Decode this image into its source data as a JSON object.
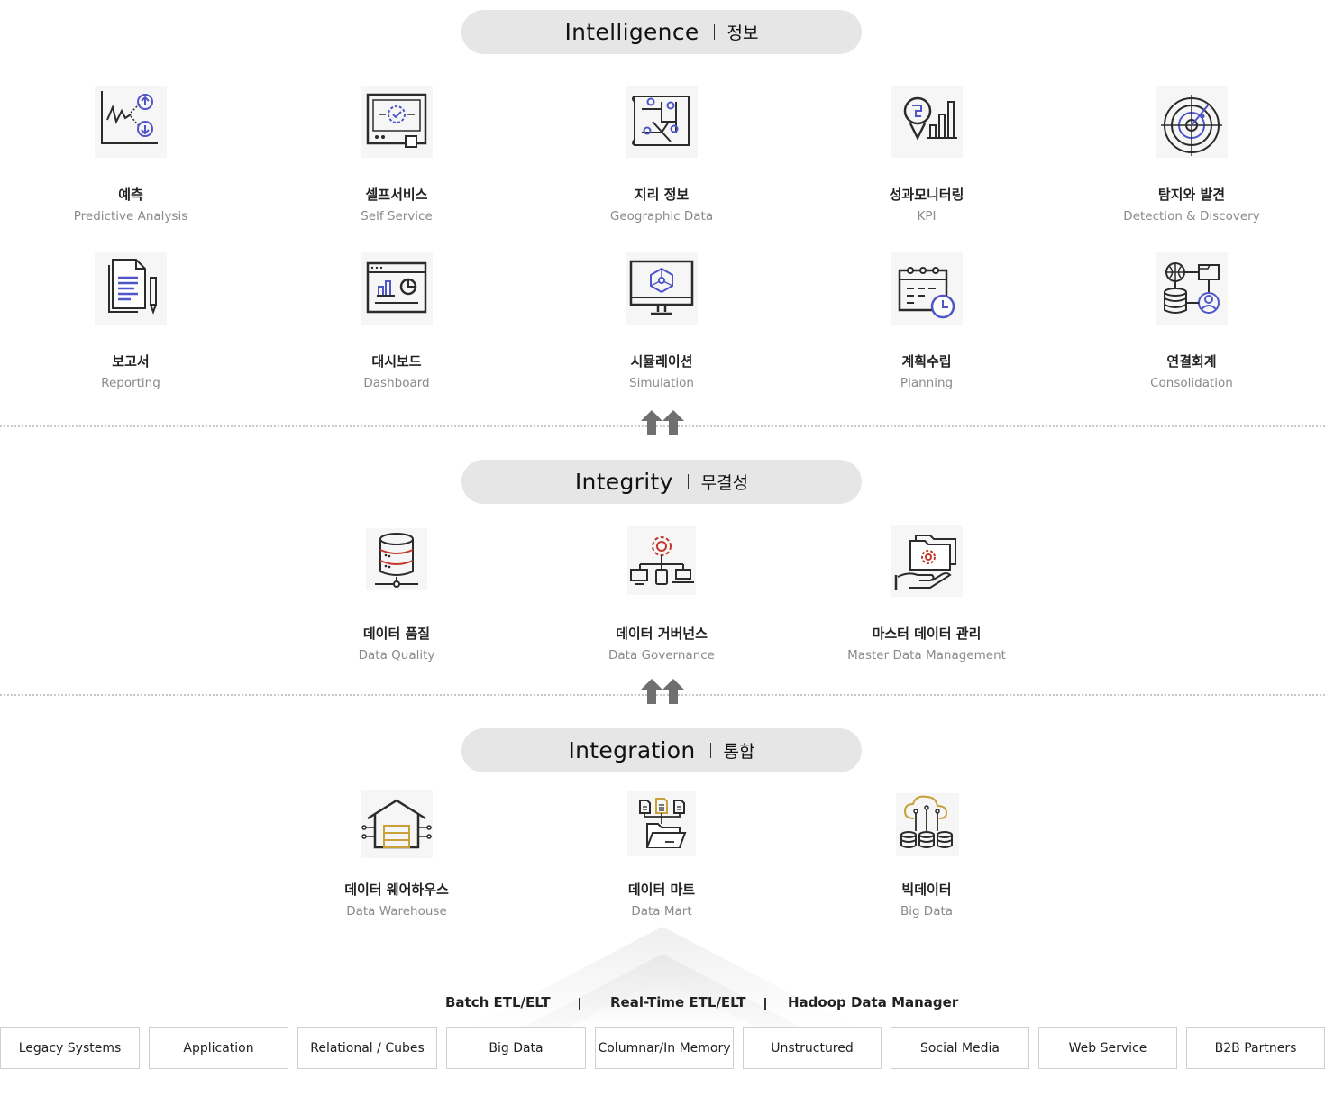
{
  "layers": {
    "intelligence": {
      "title_en": "Intelligence",
      "title_ko": "정보",
      "items": [
        {
          "ko": "예측",
          "en": "Predictive Analysis",
          "icon": "predictive-chart-icon"
        },
        {
          "ko": "셀프서비스",
          "en": "Self Service",
          "icon": "self-service-monitor-icon"
        },
        {
          "ko": "지리 정보",
          "en": "Geographic  Data",
          "icon": "geographic-map-icon"
        },
        {
          "ko": "성과모니터링",
          "en": "KPI",
          "icon": "kpi-chart-icon"
        },
        {
          "ko": "탐지와 발견",
          "en": "Detection & Discovery",
          "icon": "radar-icon"
        },
        {
          "ko": "보고서",
          "en": "Reporting",
          "icon": "report-document-icon"
        },
        {
          "ko": "대시보드",
          "en": "Dashboard",
          "icon": "dashboard-icon"
        },
        {
          "ko": "시뮬레이션",
          "en": "Simulation",
          "icon": "simulation-monitor-icon"
        },
        {
          "ko": "계획수립",
          "en": "Planning",
          "icon": "calendar-clock-icon"
        },
        {
          "ko": "연결회계",
          "en": "Consolidation",
          "icon": "consolidation-network-icon"
        }
      ]
    },
    "integrity": {
      "title_en": "Integrity",
      "title_ko": "무결성",
      "items": [
        {
          "ko": "데이터 품질",
          "en": "Data Quality",
          "icon": "database-server-icon"
        },
        {
          "ko": "데이터 거버넌스",
          "en": "Data Governance",
          "icon": "governance-gear-icon"
        },
        {
          "ko": "마스터 데이터 관리",
          "en": "Master Data Management",
          "icon": "hand-folder-gear-icon"
        }
      ]
    },
    "integration": {
      "title_en": "Integration",
      "title_ko": "통합",
      "items": [
        {
          "ko": "데이터 웨어하우스",
          "en": "Data Warehouse",
          "icon": "warehouse-icon"
        },
        {
          "ko": "데이터 마트",
          "en": "Data Mart",
          "icon": "folder-documents-icon"
        },
        {
          "ko": "빅데이터",
          "en": "Big Data",
          "icon": "cloud-database-icon"
        }
      ]
    }
  },
  "methods": [
    "Batch ETL/ELT",
    "Real-Time ETL/ELT",
    "Hadoop Data Manager"
  ],
  "sources": [
    "Legacy Systems",
    "Application",
    "Relational / Cubes",
    "Big Data",
    "Columnar/In Memory",
    "Unstructured",
    "Social Media",
    "Web Service",
    "B2B Partners"
  ],
  "colors": {
    "icon_stroke": "#2b2b2b",
    "icon_blue": "#4f56c8",
    "icon_red": "#c0392b",
    "icon_gold": "#c9a03a",
    "pill_bg": "#e6e6e6",
    "divider": "#c8c8c8",
    "arrow": "#6f6f6f"
  }
}
